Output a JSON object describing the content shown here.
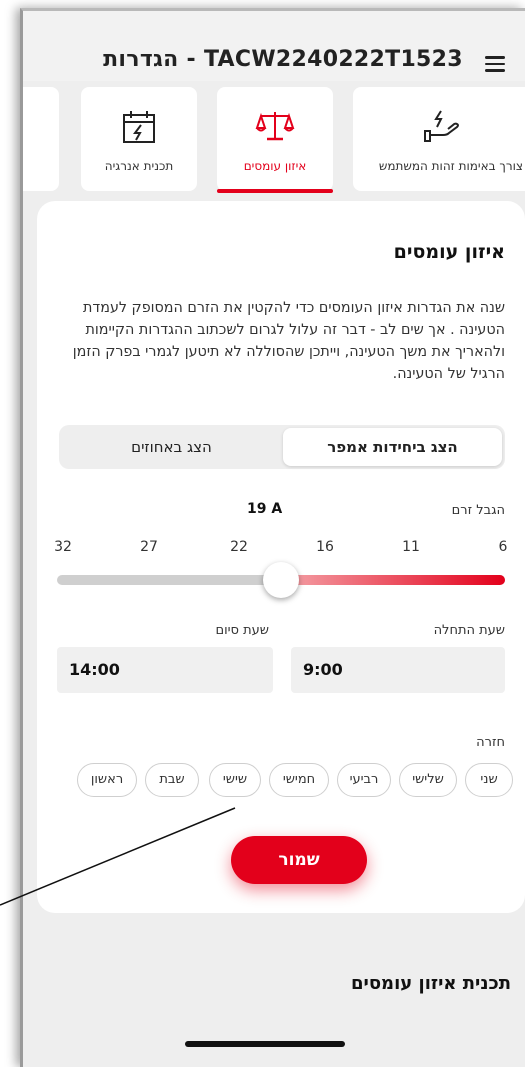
{
  "header": {
    "title": "TACW2240222T1523 - הגדרות",
    "menu_icon": "hamburger-menu-icon"
  },
  "tabs": [
    {
      "label": "צורך באימות זהות המשתמש",
      "icon": "hand-energy-icon",
      "active": false
    },
    {
      "label": "איזון עומסים",
      "icon": "scale-balance-icon",
      "active": true
    },
    {
      "label": "תכנית אנרגיה",
      "icon": "calendar-bolt-icon",
      "active": false
    }
  ],
  "card": {
    "title": "איזון עומסים",
    "description": "שנה את הגדרות איזון העומסים כדי להקטין את הזרם המסופק לעמדת הטעינה . אך שים לב - דבר זה עלול לגרום לשכתוב ההגדרות הקיימות ולהאריך את משך הטעינה, וייתכן שהסוללה לא תיטען לגמרי בפרק הזמן הרגיל של הטעינה."
  },
  "segmented": {
    "active_label": "הצג ביחידות אמפר",
    "inactive_label": "הצג באחוזים"
  },
  "current_limit": {
    "label": "הגבל זרם",
    "value_text": "19 A",
    "value": 19,
    "min": 6,
    "max": 32,
    "ticks": [
      "6",
      "11",
      "16",
      "22",
      "27",
      "32"
    ]
  },
  "times": {
    "start_label": "שעת התחלה",
    "start_value": "9:00",
    "end_label": "שעת סיום",
    "end_value": "14:00"
  },
  "repeat": {
    "label": "חזרה",
    "days": [
      {
        "label": "שני",
        "selected": false
      },
      {
        "label": "שלישי",
        "selected": false
      },
      {
        "label": "רביעי",
        "selected": false
      },
      {
        "label": "חמישי",
        "selected": false
      },
      {
        "label": "שישי",
        "selected": true
      },
      {
        "label": "שבת",
        "selected": true
      },
      {
        "label": "ראשון",
        "selected": false
      }
    ]
  },
  "save_label": "שמור",
  "section_title": "תכנית איזון עומסים",
  "colors": {
    "accent": "#e3001b",
    "background": "#eeeeee",
    "card": "#ffffff"
  }
}
